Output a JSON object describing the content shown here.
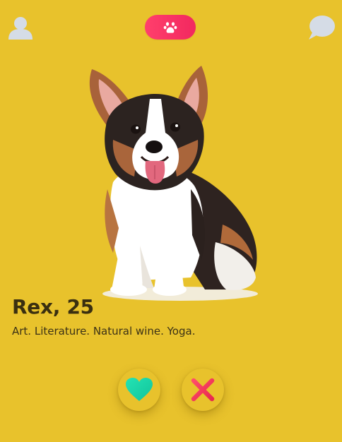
{
  "header": {
    "profile_icon": "user-icon",
    "center_tab_icon": "paw-icon",
    "chat_icon": "chat-bubble-icon",
    "accent_color": "#F22F62",
    "background_color": "#E8C22C"
  },
  "card": {
    "photo": "corgi-dog-photo",
    "name_age": "Rex, 25",
    "interests": "Art. Literature. Natural wine. Yoga."
  },
  "actions": {
    "like_icon": "heart-icon",
    "like_color": "#1FD3A8",
    "nope_icon": "close-icon",
    "nope_color": "#F23A5E"
  }
}
